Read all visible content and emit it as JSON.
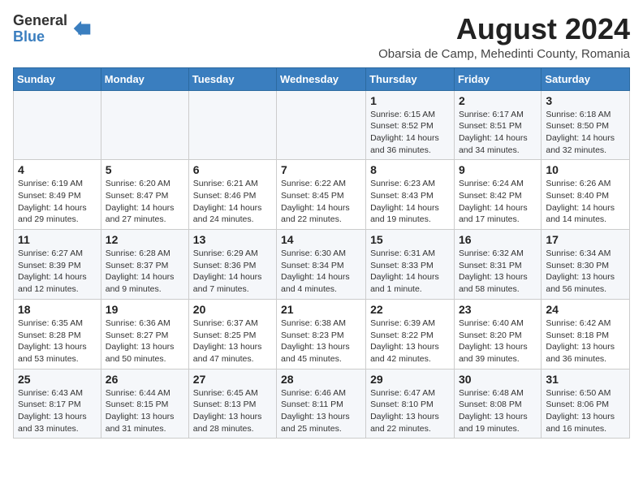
{
  "logo": {
    "general": "General",
    "blue": "Blue"
  },
  "title": "August 2024",
  "subtitle": "Obarsia de Camp, Mehedinti County, Romania",
  "days_of_week": [
    "Sunday",
    "Monday",
    "Tuesday",
    "Wednesday",
    "Thursday",
    "Friday",
    "Saturday"
  ],
  "weeks": [
    [
      {
        "day": "",
        "info": ""
      },
      {
        "day": "",
        "info": ""
      },
      {
        "day": "",
        "info": ""
      },
      {
        "day": "",
        "info": ""
      },
      {
        "day": "1",
        "info": "Sunrise: 6:15 AM\nSunset: 8:52 PM\nDaylight: 14 hours and 36 minutes."
      },
      {
        "day": "2",
        "info": "Sunrise: 6:17 AM\nSunset: 8:51 PM\nDaylight: 14 hours and 34 minutes."
      },
      {
        "day": "3",
        "info": "Sunrise: 6:18 AM\nSunset: 8:50 PM\nDaylight: 14 hours and 32 minutes."
      }
    ],
    [
      {
        "day": "4",
        "info": "Sunrise: 6:19 AM\nSunset: 8:49 PM\nDaylight: 14 hours and 29 minutes."
      },
      {
        "day": "5",
        "info": "Sunrise: 6:20 AM\nSunset: 8:47 PM\nDaylight: 14 hours and 27 minutes."
      },
      {
        "day": "6",
        "info": "Sunrise: 6:21 AM\nSunset: 8:46 PM\nDaylight: 14 hours and 24 minutes."
      },
      {
        "day": "7",
        "info": "Sunrise: 6:22 AM\nSunset: 8:45 PM\nDaylight: 14 hours and 22 minutes."
      },
      {
        "day": "8",
        "info": "Sunrise: 6:23 AM\nSunset: 8:43 PM\nDaylight: 14 hours and 19 minutes."
      },
      {
        "day": "9",
        "info": "Sunrise: 6:24 AM\nSunset: 8:42 PM\nDaylight: 14 hours and 17 minutes."
      },
      {
        "day": "10",
        "info": "Sunrise: 6:26 AM\nSunset: 8:40 PM\nDaylight: 14 hours and 14 minutes."
      }
    ],
    [
      {
        "day": "11",
        "info": "Sunrise: 6:27 AM\nSunset: 8:39 PM\nDaylight: 14 hours and 12 minutes."
      },
      {
        "day": "12",
        "info": "Sunrise: 6:28 AM\nSunset: 8:37 PM\nDaylight: 14 hours and 9 minutes."
      },
      {
        "day": "13",
        "info": "Sunrise: 6:29 AM\nSunset: 8:36 PM\nDaylight: 14 hours and 7 minutes."
      },
      {
        "day": "14",
        "info": "Sunrise: 6:30 AM\nSunset: 8:34 PM\nDaylight: 14 hours and 4 minutes."
      },
      {
        "day": "15",
        "info": "Sunrise: 6:31 AM\nSunset: 8:33 PM\nDaylight: 14 hours and 1 minute."
      },
      {
        "day": "16",
        "info": "Sunrise: 6:32 AM\nSunset: 8:31 PM\nDaylight: 13 hours and 58 minutes."
      },
      {
        "day": "17",
        "info": "Sunrise: 6:34 AM\nSunset: 8:30 PM\nDaylight: 13 hours and 56 minutes."
      }
    ],
    [
      {
        "day": "18",
        "info": "Sunrise: 6:35 AM\nSunset: 8:28 PM\nDaylight: 13 hours and 53 minutes."
      },
      {
        "day": "19",
        "info": "Sunrise: 6:36 AM\nSunset: 8:27 PM\nDaylight: 13 hours and 50 minutes."
      },
      {
        "day": "20",
        "info": "Sunrise: 6:37 AM\nSunset: 8:25 PM\nDaylight: 13 hours and 47 minutes."
      },
      {
        "day": "21",
        "info": "Sunrise: 6:38 AM\nSunset: 8:23 PM\nDaylight: 13 hours and 45 minutes."
      },
      {
        "day": "22",
        "info": "Sunrise: 6:39 AM\nSunset: 8:22 PM\nDaylight: 13 hours and 42 minutes."
      },
      {
        "day": "23",
        "info": "Sunrise: 6:40 AM\nSunset: 8:20 PM\nDaylight: 13 hours and 39 minutes."
      },
      {
        "day": "24",
        "info": "Sunrise: 6:42 AM\nSunset: 8:18 PM\nDaylight: 13 hours and 36 minutes."
      }
    ],
    [
      {
        "day": "25",
        "info": "Sunrise: 6:43 AM\nSunset: 8:17 PM\nDaylight: 13 hours and 33 minutes."
      },
      {
        "day": "26",
        "info": "Sunrise: 6:44 AM\nSunset: 8:15 PM\nDaylight: 13 hours and 31 minutes."
      },
      {
        "day": "27",
        "info": "Sunrise: 6:45 AM\nSunset: 8:13 PM\nDaylight: 13 hours and 28 minutes."
      },
      {
        "day": "28",
        "info": "Sunrise: 6:46 AM\nSunset: 8:11 PM\nDaylight: 13 hours and 25 minutes."
      },
      {
        "day": "29",
        "info": "Sunrise: 6:47 AM\nSunset: 8:10 PM\nDaylight: 13 hours and 22 minutes."
      },
      {
        "day": "30",
        "info": "Sunrise: 6:48 AM\nSunset: 8:08 PM\nDaylight: 13 hours and 19 minutes."
      },
      {
        "day": "31",
        "info": "Sunrise: 6:50 AM\nSunset: 8:06 PM\nDaylight: 13 hours and 16 minutes."
      }
    ]
  ]
}
